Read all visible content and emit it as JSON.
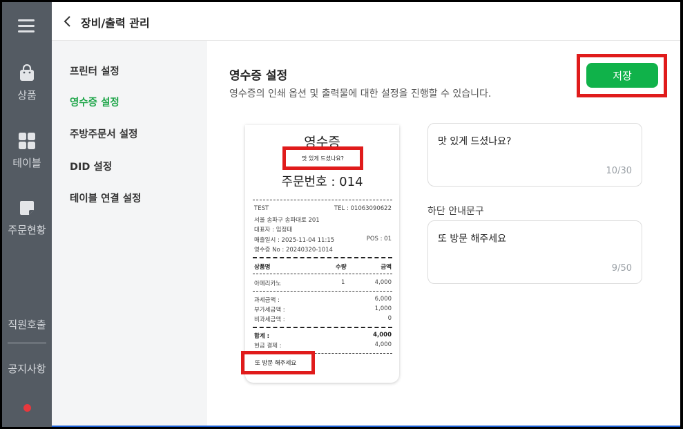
{
  "app": {
    "page_title": "장비/출력 관리"
  },
  "rail": {
    "items": [
      {
        "label": "상품",
        "icon": "shopping-bag-icon"
      },
      {
        "label": "테이블",
        "icon": "grid-icon"
      },
      {
        "label": "주문현황",
        "icon": "note-icon"
      }
    ],
    "bottom_items": [
      {
        "label": "직원호출"
      },
      {
        "label": "공지사항"
      }
    ]
  },
  "menu": {
    "items": [
      {
        "label": "프린터 설정",
        "active": false
      },
      {
        "label": "영수증 설정",
        "active": true
      },
      {
        "label": "주방주문서 설정",
        "active": false
      },
      {
        "label": "DID 설정",
        "active": false
      },
      {
        "label": "테이블 연결 설정",
        "active": false
      }
    ]
  },
  "main": {
    "title": "영수증 설정",
    "description": "영수증의 인쇄 옵션 및 출력물에 대한 설정을 진행할 수 있습니다.",
    "save_label": "저장"
  },
  "receipt": {
    "title": "영수증",
    "top_message": "맛 있게 드셨나요?",
    "order_number": "주문번호 : 014",
    "store_name": "TEST",
    "tel": "TEL : 01063090622",
    "address": "서울 송파구 송파대로 201",
    "owner": "대표자 : 임정태",
    "sale_datetime": "매출일시 : 2025-11-04 11:15",
    "pos": "POS : 01",
    "receipt_no": "영수증 No : 20240320-1014",
    "headers": {
      "name": "상품명",
      "qty": "수량",
      "amount": "금액"
    },
    "items": [
      {
        "name": "아메리카노",
        "qty": "1",
        "amount": "4,000"
      }
    ],
    "taxable_label": "과세금액 :",
    "taxable_value": "6,000",
    "vat_label": "부가세금액 :",
    "vat_value": "1,000",
    "nontax_label": "비과세금액 :",
    "nontax_value": "0",
    "total_label": "합계 :",
    "total_value": "4,000",
    "cash_label": "현금 결제 :",
    "cash_value": "4,000",
    "bottom_message": "또 방문 해주세요"
  },
  "fields": {
    "top_message": {
      "value": "맛 있게 드셨나요?",
      "count": "10/30"
    },
    "bottom_label": "하단 안내문구",
    "bottom_message": {
      "value": "또 방문 해주세요",
      "count": "9/50"
    }
  },
  "colors": {
    "accent_green": "#10b24a",
    "active_menu": "#1fa64a",
    "rail_bg": "#545b63",
    "highlight_red": "#e01b1b"
  }
}
